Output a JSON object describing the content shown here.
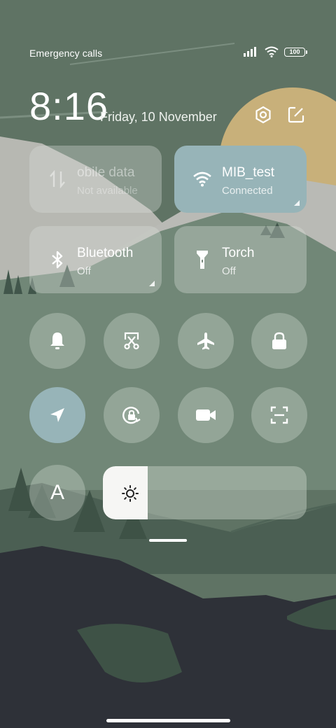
{
  "status_bar": {
    "carrier_text": "Emergency calls",
    "battery_level": "100",
    "icons": [
      "signal-icon",
      "wifi-icon",
      "battery-icon"
    ]
  },
  "header": {
    "time": "8:16",
    "date": "Friday, 10 November",
    "icons": [
      "settings-icon",
      "edit-icon"
    ]
  },
  "tiles": {
    "mobile_data": {
      "label": "obile data",
      "status": "Not available",
      "icon": "mobile-data-icon"
    },
    "wifi": {
      "label": "MIB_test",
      "status": "Connected",
      "icon": "wifi-icon"
    },
    "bluetooth": {
      "label": "Bluetooth",
      "status": "Off",
      "icon": "bluetooth-icon"
    },
    "torch": {
      "label": "Torch",
      "status": "Off",
      "icon": "flashlight-icon"
    }
  },
  "toggles_row1": [
    "bell-icon",
    "screenshot-crop-icon",
    "airplane-icon",
    "lock-icon"
  ],
  "toggles_row2": [
    "location-icon",
    "rotation-lock-icon",
    "video-camera-icon",
    "scan-icon"
  ],
  "font_button": {
    "label": "A"
  },
  "brightness": {
    "level": 0.22,
    "icon": "brightness-icon"
  },
  "colors": {
    "active_tile": "#97b4b8",
    "tile": "#d7ded75c",
    "background": "#5f7364",
    "sun": "#c8b07a"
  }
}
